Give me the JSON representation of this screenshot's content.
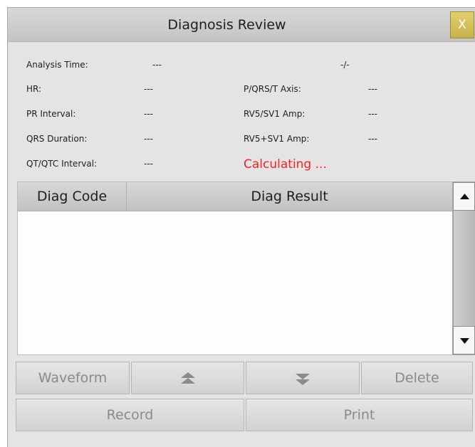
{
  "dialog": {
    "title": "Diagnosis Review",
    "close_label": "X"
  },
  "info": {
    "analysis_time": {
      "label": "Analysis Time:",
      "value": "---",
      "extra": "-/-"
    },
    "hr": {
      "label": "HR:",
      "value": "---"
    },
    "pr_interval": {
      "label": "PR Interval:",
      "value": "---"
    },
    "qrs_duration": {
      "label": "QRS Duration:",
      "value": "---"
    },
    "qt_qtc_interval": {
      "label": "QT/QTC Interval:",
      "value": "---"
    },
    "pqrst_axis": {
      "label": "P/QRS/T Axis:",
      "value": "---"
    },
    "rv5_sv1_amp": {
      "label": "RV5/SV1 Amp:",
      "value": "---"
    },
    "rv5_plus_sv1_amp": {
      "label": "RV5+SV1 Amp:",
      "value": "---"
    },
    "status": "Calculating ...",
    "status_color": "#ff2020"
  },
  "table": {
    "columns": [
      "Diag Code",
      "Diag Result"
    ],
    "rows": []
  },
  "buttons": {
    "waveform": "Waveform",
    "page_up_icon": "double-chevron-up-icon",
    "page_down_icon": "double-chevron-down-icon",
    "delete": "Delete",
    "record": "Record",
    "print": "Print"
  },
  "colors": {
    "close_button": "#d4c05a",
    "disabled_text": "#8a8a8a"
  }
}
